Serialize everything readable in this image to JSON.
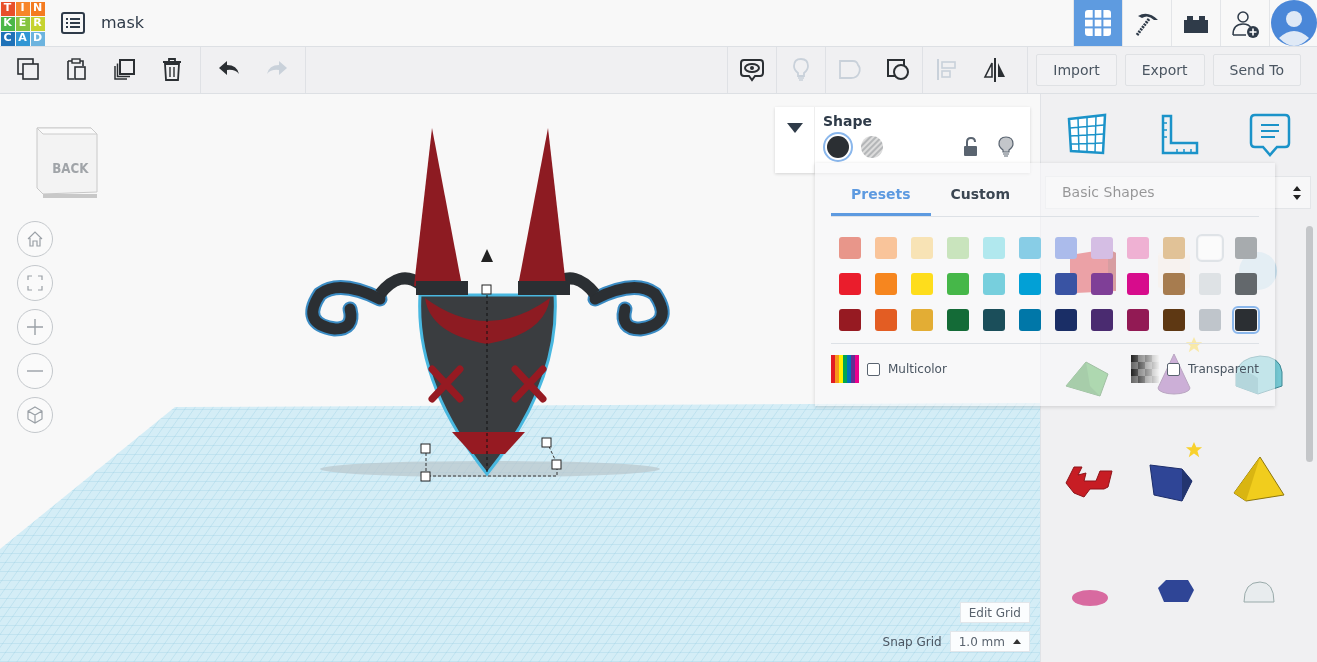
{
  "logo": {
    "letters": [
      {
        "text": "T",
        "color": "#e8502a"
      },
      {
        "text": "I",
        "color": "#f7862a"
      },
      {
        "text": "N",
        "color": "#f47b20"
      },
      {
        "text": "K",
        "color": "#4cb748"
      },
      {
        "text": "E",
        "color": "#86c441"
      },
      {
        "text": "R",
        "color": "#c6d330"
      },
      {
        "text": "C",
        "color": "#1f72b8"
      },
      {
        "text": "A",
        "color": "#3196d4"
      },
      {
        "text": "D",
        "color": "#6db4df"
      }
    ]
  },
  "design": {
    "title": "mask"
  },
  "header_tools": [
    {
      "kind": "grid",
      "selected": true
    },
    {
      "kind": "pickaxe",
      "selected": false
    },
    {
      "kind": "bricks",
      "selected": false
    },
    {
      "kind": "add-user",
      "selected": false
    }
  ],
  "toolbar": {
    "edit_tools": [
      {
        "kind": "copy",
        "disabled": false
      },
      {
        "kind": "paste",
        "disabled": false
      },
      {
        "kind": "duplicate",
        "disabled": false
      },
      {
        "kind": "delete",
        "disabled": false
      }
    ],
    "history_tools": [
      {
        "kind": "undo",
        "disabled": false
      },
      {
        "kind": "redo",
        "disabled": true
      }
    ],
    "shape_tools": [
      {
        "kind": "note",
        "disabled": false
      },
      {
        "kind": "light",
        "disabled": true
      },
      {
        "kind": "group",
        "disabled": true
      },
      {
        "kind": "ungroup",
        "disabled": false
      },
      {
        "kind": "align",
        "disabled": true
      },
      {
        "kind": "mirror",
        "disabled": false
      }
    ],
    "buttons": [
      "Import",
      "Export",
      "Send To"
    ]
  },
  "view_cube": {
    "label": "BACK"
  },
  "nav_buttons": [
    {
      "kind": "home"
    },
    {
      "kind": "fit"
    },
    {
      "kind": "zoom-in"
    },
    {
      "kind": "zoom-out"
    },
    {
      "kind": "perspective"
    }
  ],
  "shape_panel": {
    "title": "Shape",
    "modes": [
      {
        "kind": "solid",
        "selected": true
      },
      {
        "kind": "hole",
        "selected": false
      }
    ],
    "locked": false
  },
  "color_popover": {
    "tabs": [
      {
        "label": "Presets",
        "selected": true
      },
      {
        "label": "Custom",
        "selected": false
      }
    ],
    "swatches": [
      {
        "color": "#e8968a",
        "selected": false
      },
      {
        "color": "#f9c49a",
        "selected": false
      },
      {
        "color": "#f8e3b5",
        "selected": false
      },
      {
        "color": "#c9e4bd",
        "selected": false
      },
      {
        "color": "#b1e8ee",
        "selected": false
      },
      {
        "color": "#88cde6",
        "selected": false
      },
      {
        "color": "#abbbeb",
        "selected": false
      },
      {
        "color": "#d5bee4",
        "selected": false
      },
      {
        "color": "#efb1d3",
        "selected": false
      },
      {
        "color": "#e1c297",
        "selected": false
      },
      {
        "color": "#fbfbfb",
        "selected": false
      },
      {
        "color": "#a7abae",
        "selected": false
      },
      {
        "color": "#ea1d2c",
        "selected": false
      },
      {
        "color": "#f6861f",
        "selected": false
      },
      {
        "color": "#fedd1c",
        "selected": false
      },
      {
        "color": "#46b749",
        "selected": false
      },
      {
        "color": "#77cfdd",
        "selected": false
      },
      {
        "color": "#02a0d6",
        "selected": false
      },
      {
        "color": "#3953a3",
        "selected": false
      },
      {
        "color": "#7f3f97",
        "selected": false
      },
      {
        "color": "#d70c8c",
        "selected": false
      },
      {
        "color": "#a77c4f",
        "selected": false
      },
      {
        "color": "#dee2e5",
        "selected": false
      },
      {
        "color": "#63686c",
        "selected": false
      },
      {
        "color": "#961a22",
        "selected": false
      },
      {
        "color": "#e35d23",
        "selected": false
      },
      {
        "color": "#e3ad34",
        "selected": false
      },
      {
        "color": "#146b37",
        "selected": false
      },
      {
        "color": "#1b4e5a",
        "selected": false
      },
      {
        "color": "#0077a8",
        "selected": false
      },
      {
        "color": "#1a2e66",
        "selected": false
      },
      {
        "color": "#4a2b70",
        "selected": false
      },
      {
        "color": "#921a54",
        "selected": false
      },
      {
        "color": "#5e3813",
        "selected": false
      },
      {
        "color": "#bfc5cb",
        "selected": false
      },
      {
        "color": "#2b2f33",
        "selected": true
      }
    ],
    "options": [
      {
        "kind": "multicolor",
        "label": "Multicolor",
        "checked": false
      },
      {
        "kind": "transparent",
        "label": "Transparent",
        "checked": false
      }
    ]
  },
  "sidebar": {
    "tools": [
      {
        "kind": "workplane"
      },
      {
        "kind": "ruler"
      },
      {
        "kind": "notes"
      }
    ],
    "category": "Basic Shapes",
    "shapes": [
      {
        "kind": "box",
        "starred": false
      },
      {
        "kind": "cylinder",
        "starred": false
      },
      {
        "kind": "sphere",
        "starred": false
      },
      {
        "kind": "wedge",
        "starred": false
      },
      {
        "kind": "cone",
        "starred": true
      },
      {
        "kind": "half-cylinder",
        "starred": false
      },
      {
        "kind": "text",
        "starred": false
      },
      {
        "kind": "prism",
        "starred": true
      },
      {
        "kind": "pyramid",
        "starred": false
      },
      {
        "kind": "torus",
        "starred": false
      },
      {
        "kind": "hexagon",
        "starred": false
      },
      {
        "kind": "dome",
        "starred": false
      }
    ]
  },
  "grid_controls": {
    "edit_button": "Edit Grid",
    "snap_label": "Snap Grid",
    "snap_value": "1.0 mm"
  }
}
